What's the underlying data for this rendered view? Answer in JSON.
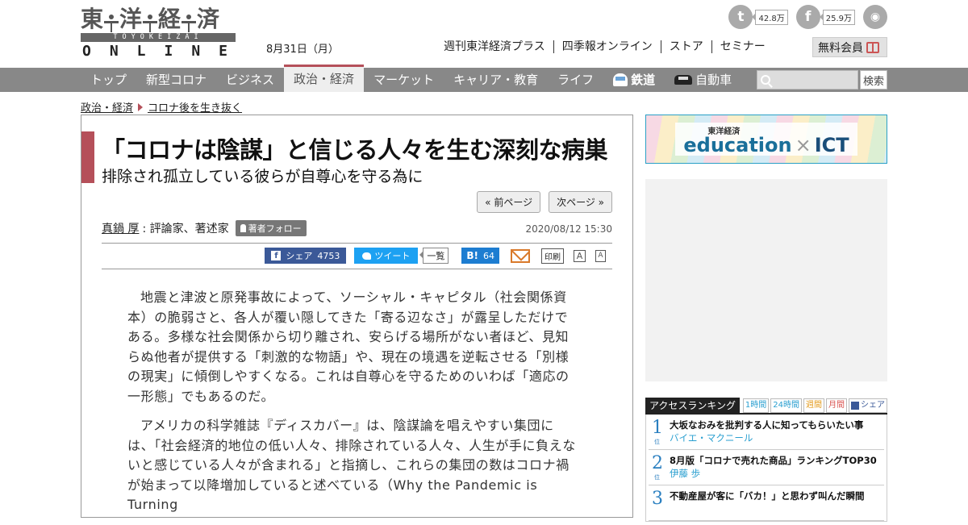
{
  "header": {
    "logo_kanji": [
      "東",
      "洋",
      "経",
      "済"
    ],
    "logo_sub": "TOYOKEIZAI",
    "logo_online": "ONLINE",
    "date": "8月31日（月）",
    "twitter_count": "42.8万",
    "facebook_count": "25.9万",
    "top_links": [
      "週刊東洋経済プラス",
      "四季報オンライン",
      "ストア",
      "セミナー"
    ],
    "member_label": "無料会員"
  },
  "nav": {
    "items": [
      "トップ",
      "新型コロナ",
      "ビジネス",
      "政治・経済",
      "マーケット",
      "キャリア・教育",
      "ライフ"
    ],
    "active_index": 3,
    "railway": "鉄道",
    "auto": "自動車",
    "search_button": "検索"
  },
  "breadcrumb": {
    "parent": "政治・経済",
    "child": "コロナ後を生き抜く"
  },
  "article": {
    "title": "「コロナは陰謀」と信じる人々を生む深刻な病巣",
    "subtitle": "排除され孤立している彼らが自尊心を守る為に",
    "prev_page": "« 前ページ",
    "next_page": "次ページ »",
    "author_name": "真鍋 厚",
    "author_role": ": 評論家、著述家",
    "follow_label": "著者フォロー",
    "published": "2020/08/12 15:30",
    "share": {
      "facebook_label": "シェア",
      "facebook_count": "4753",
      "tweet_label": "ツイート",
      "list_label": "一覧",
      "hatena_label": "B!",
      "hatena_count": "64",
      "print_label": "印刷",
      "font_large": "A",
      "font_small": "A"
    },
    "paragraphs": [
      "地震と津波と原発事故によって、ソーシャル・キャピタル（社会関係資本）の脆弱さと、各人が覆い隠してきた「寄る辺なさ」が露呈しただけである。多様な社会関係から切り離され、安らげる場所がない者ほど、見知らぬ他者が提供する「刺激的な物語」や、現在の境遇を逆転させる「別様の現実」に傾倒しやすくなる。これは自尊心を守るためのいわば「適応の一形態」でもあるのだ。",
      "アメリカの科学雑誌『ディスカバー』は、陰謀論を唱えやすい集団には、「社会経済的地位の低い人々、排除されている人々、人生が手に負えないと感じている人々が含まれる」と指摘し、これらの集団の数はコロナ禍が始まって以降増加していると述べている（Why the Pandemic is Turning"
    ]
  },
  "sidebar": {
    "edu_small": "東洋経済",
    "edu_main": "education",
    "edu_cross": "×",
    "edu_ict": "ICT",
    "ranking_title": "アクセスランキング",
    "ranking_tabs": [
      "1時間",
      "24時間",
      "週間",
      "月間",
      "シェア"
    ],
    "ranking_suffix": "位",
    "ranking": [
      {
        "rank": "1",
        "title": "大坂なおみを批判する人に知ってもらいたい事",
        "author": "バイエ・マクニール"
      },
      {
        "rank": "2",
        "title": "8月版「コロナで売れた商品」ランキングTOP30",
        "author": "伊藤 歩"
      },
      {
        "rank": "3",
        "title": "不動産屋が客に「バカ！」と思わず叫んだ瞬間",
        "author": ""
      }
    ]
  },
  "colors": {
    "accent": "#b5505a",
    "nav_bg": "#888888",
    "link_blue": "#2a9fd0",
    "facebook": "#3b5998",
    "twitter": "#1da1f2",
    "hatena": "#1d7dd1"
  }
}
